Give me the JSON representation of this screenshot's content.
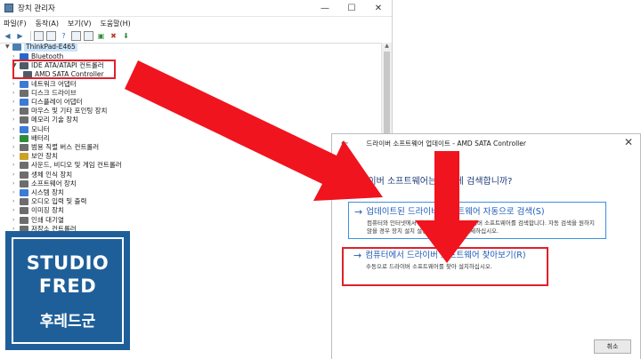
{
  "window": {
    "title": "장치 관리자",
    "minimize": "—",
    "maximize": "☐",
    "close": "✕"
  },
  "menu": [
    "파일(F)",
    "동작(A)",
    "보기(V)",
    "도움말(H)"
  ],
  "tree": {
    "root": "ThinkPad-E465",
    "nodes": [
      {
        "label": "Bluetooth",
        "color": "#2a66c9",
        "expanded": false
      },
      {
        "label": "IDE ATA/ATAPI 컨트롤러",
        "color": "#4f5b66",
        "expanded": true
      },
      {
        "label": "AMD SATA Controller",
        "color": "#4f5b66",
        "child": true
      },
      {
        "label": "네트워크 어댑터",
        "color": "#3a7bd5",
        "expanded": false
      },
      {
        "label": "디스크 드라이브",
        "color": "#6d6d6d",
        "expanded": false
      },
      {
        "label": "디스플레이 어댑터",
        "color": "#3a7bd5",
        "expanded": false
      },
      {
        "label": "마우스 및 기타 포인팅 장치",
        "color": "#6d6d6d",
        "expanded": false
      },
      {
        "label": "메모리 기술 장치",
        "color": "#6d6d6d",
        "expanded": false
      },
      {
        "label": "모니터",
        "color": "#3a7bd5",
        "expanded": false
      },
      {
        "label": "배터리",
        "color": "#2e8b3a",
        "expanded": false
      },
      {
        "label": "범용 직렬 버스 컨트롤러",
        "color": "#6d6d6d",
        "expanded": false
      },
      {
        "label": "보안 장치",
        "color": "#c9a227",
        "expanded": false
      },
      {
        "label": "사운드, 비디오 및 게임 컨트롤러",
        "color": "#6d6d6d",
        "expanded": false
      },
      {
        "label": "생체 인식 장치",
        "color": "#6d6d6d",
        "expanded": false
      },
      {
        "label": "소프트웨어 장치",
        "color": "#6d6d6d",
        "expanded": false
      },
      {
        "label": "시스템 장치",
        "color": "#3a7bd5",
        "expanded": false
      },
      {
        "label": "오디오 입력 및 출력",
        "color": "#6d6d6d",
        "expanded": false
      },
      {
        "label": "이미징 장치",
        "color": "#6d6d6d",
        "expanded": false
      },
      {
        "label": "인쇄 대기열",
        "color": "#6d6d6d",
        "expanded": false
      },
      {
        "label": "저장소 컨트롤러",
        "color": "#6d6d6d",
        "expanded": false
      }
    ]
  },
  "dialog": {
    "title": "드라이버 소프트웨어 업데이트 - AMD SATA Controller",
    "question": "드라이버 소프트웨어는 어떻게 검색합니까?",
    "option1": {
      "heading": "업데이트된 드라이버 소프트웨어 자동으로 검색(S)",
      "description": "컴퓨터와 인터넷에서 해당 장치의 최신 드라이버 소프트웨어를 검색합니다. 자동 검색을 원하지 않을 경우 장치 설치 설정에서 이 기능을 해제하십시오."
    },
    "option2": {
      "heading": "컴퓨터에서 드라이버 소프트웨어 찾아보기(R)",
      "description": "수동으로 드라이버 소프트웨어를 찾아 설치하십시오."
    },
    "cancel": "취소",
    "close": "✕"
  },
  "logo": {
    "line1": "STUDIO",
    "line2": "FRED",
    "line3": "후레드군"
  },
  "colors": {
    "annotation": "#e0202a",
    "logo_bg": "#1f5f99",
    "link": "#1e5bb8"
  }
}
